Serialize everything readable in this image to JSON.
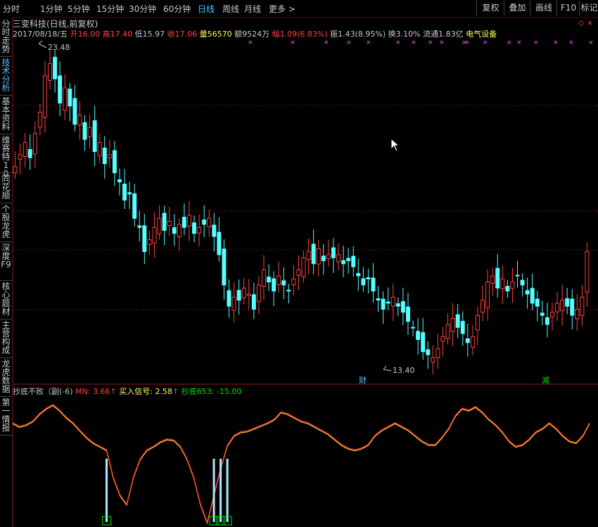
{
  "tabs": [
    "分时",
    "1分钟",
    "5分钟",
    "15分钟",
    "30分钟",
    "60分钟",
    "日线",
    "周线",
    "月线",
    "更多 >"
  ],
  "active_tab": "日线",
  "right_buttons": [
    "复权",
    "叠加",
    "画线",
    "F10",
    "标记"
  ],
  "close_mark": "◇ ×",
  "sidebar": [
    "分时走势",
    "技术分析",
    "基本资料",
    "维赛特10",
    "同花顺",
    "个股龙虎",
    "深度F9",
    "核心题材",
    "主营构成",
    "龙虎数据",
    "第一情报"
  ],
  "sidebar_active": "技术分析",
  "stock_title": "三变科技(日线,前复权)",
  "quote": {
    "date": "2017/08/18/五",
    "open_label": "开",
    "open": "16.00",
    "high_label": "高",
    "high": "17.40",
    "low_label": "低",
    "low": "15.97",
    "close_label": "收",
    "close": "17.06",
    "volume_label": "量",
    "volume": "56570",
    "amount_label": "额",
    "amount": "9524万",
    "change_label": "幅",
    "change": "1.09(6.83%)",
    "amplitude_label": "振",
    "amplitude": "1.43(8.95%)",
    "turnover_label": "换",
    "turnover": "3.10%",
    "float_label": "流通",
    "float": "1.83亿",
    "sector": "电气设备"
  },
  "price_high_label": "23.48",
  "price_low_label": "13.40",
  "event_labels": [
    "财",
    "减"
  ],
  "indicator": {
    "name": "抄底不败（副(-6)",
    "mn_label": "MN:",
    "mn_value": "3.66",
    "buy_label": "买入信号:",
    "buy_value": "2.58",
    "bottom_label": "抄底653:",
    "bottom_value": "-15.00"
  },
  "colors": {
    "up": "#ff4040",
    "down": "#54ffff",
    "accent": "#4fc3ff",
    "yellow": "#ffff54",
    "green": "#00e000",
    "magenta": "#ff50ff"
  },
  "chart_data": {
    "type": "candlestick",
    "ylim": [
      13.0,
      24.0
    ],
    "max": 23.48,
    "min": 13.4,
    "closes": [
      19.8,
      20.2,
      20.6,
      20.1,
      20.9,
      21.6,
      22.8,
      23.2,
      22.7,
      21.9,
      22.4,
      21.8,
      21.2,
      21.5,
      20.7,
      21.1,
      20.3,
      20.6,
      19.9,
      20.2,
      19.6,
      19.3,
      18.7,
      18.9,
      18.1,
      17.8,
      17.0,
      17.4,
      17.8,
      18.1,
      17.7,
      18.0,
      17.6,
      17.9,
      17.8,
      18.2,
      17.6,
      17.8,
      17.9,
      18.1,
      17.5,
      16.9,
      15.9,
      15.2,
      15.5,
      15.4,
      15.8,
      15.6,
      15.1,
      15.9,
      16.4,
      16.0,
      15.7,
      16.2,
      15.9,
      15.7,
      16.1,
      16.4,
      16.8,
      17.0,
      16.6,
      17.1,
      16.7,
      16.9,
      16.8,
      16.9,
      16.6,
      16.7,
      16.5,
      16.2,
      15.9,
      16.1,
      15.7,
      15.4,
      15.1,
      15.3,
      15.5,
      15.2,
      15.0,
      14.7,
      14.5,
      14.1,
      13.7,
      13.6,
      13.5,
      13.8,
      14.2,
      14.6,
      14.8,
      14.5,
      14.3,
      14.0,
      14.2,
      14.9,
      15.4,
      16.0,
      16.2,
      15.8,
      16.1,
      15.7,
      16.0,
      16.2,
      15.9,
      15.6,
      15.3,
      15.2,
      14.9,
      14.6,
      15.0,
      15.3,
      15.4,
      15.2,
      14.9,
      15.1,
      15.5,
      17.0
    ],
    "indicator_values": [
      3,
      2.6,
      2.8,
      3.2,
      4,
      4.6,
      5,
      4.4,
      3.6,
      3.0,
      2.2,
      1.4,
      0.8,
      0.4,
      0,
      -3,
      -5,
      -6,
      -3,
      -1,
      0,
      0.4,
      0.9,
      1.2,
      1.1,
      0.4,
      -1,
      -3,
      -6,
      -8,
      -5,
      -2,
      0.5,
      1.6,
      2.0,
      2.1,
      2.4,
      2.7,
      3.0,
      3.4,
      4.2,
      4.0,
      3.6,
      3.2,
      3.0,
      2.6,
      2.2,
      1.8,
      1.2,
      0.6,
      0.2,
      0,
      0.2,
      0.6,
      1.6,
      2.2,
      2.6,
      3.0,
      2.6,
      2.2,
      1.6,
      1.0,
      0.6,
      0.6,
      1.4,
      2.4,
      3.8,
      4.6,
      4.4,
      4.8,
      4.2,
      3.4,
      2.8,
      2.0,
      1.0,
      0.4,
      0.6,
      1.2,
      2.0,
      2.4,
      3.0,
      2.4,
      1.6,
      1.0,
      0.8,
      1.6,
      3.0
    ],
    "ind_ylim": [
      -8,
      5
    ],
    "signal_bars": [
      14,
      30,
      31,
      32
    ]
  }
}
